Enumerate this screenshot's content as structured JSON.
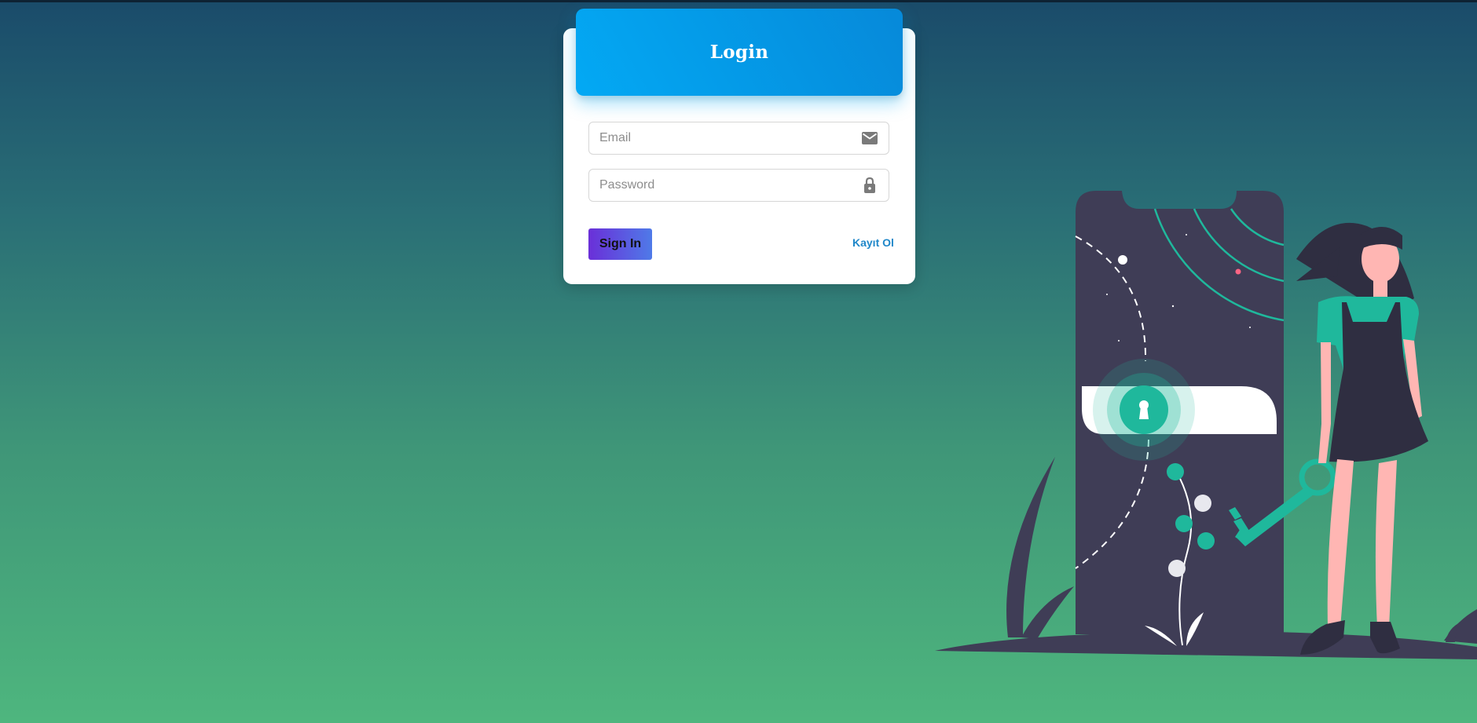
{
  "login": {
    "title": "Login",
    "email_placeholder": "Email",
    "password_placeholder": "Password",
    "signin_label": "Sign In",
    "register_label": "Kayıt Ol"
  },
  "icons": {
    "email": "envelope-icon",
    "password": "lock-icon",
    "illustration_keyhole": "keyhole-icon"
  },
  "colors": {
    "header_gradient_start": "#03a9f4",
    "header_gradient_end": "#0689d9",
    "button_gradient_start": "#6a2fd8",
    "button_gradient_end": "#4f7ae8",
    "link": "#1f87c9",
    "accent_teal": "#1fb89c",
    "phone_body": "#3f3d56",
    "skin": "#ffb6b3"
  }
}
